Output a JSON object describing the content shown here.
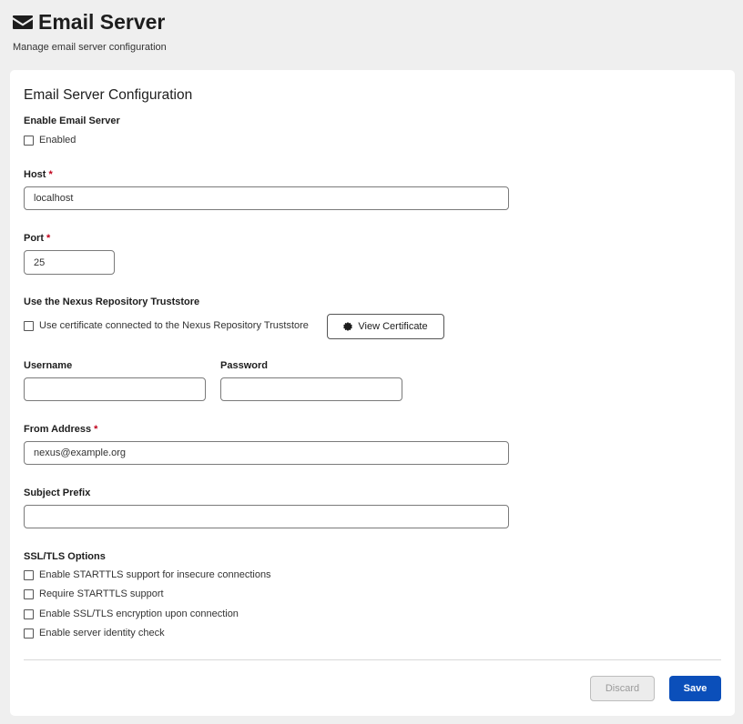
{
  "header": {
    "title": "Email Server",
    "subtitle": "Manage email server configuration",
    "icon": "envelope-icon"
  },
  "card": {
    "title": "Email Server Configuration",
    "enable": {
      "label": "Enable Email Server",
      "checkbox_label": "Enabled",
      "checked": false
    },
    "host": {
      "label": "Host",
      "required_mark": "*",
      "value": "localhost"
    },
    "port": {
      "label": "Port",
      "required_mark": "*",
      "value": "25"
    },
    "truststore": {
      "label": "Use the Nexus Repository Truststore",
      "checkbox_label": "Use certificate connected to the Nexus Repository Truststore",
      "checked": false,
      "view_button": "View Certificate",
      "view_icon": "certificate-icon"
    },
    "username": {
      "label": "Username",
      "value": ""
    },
    "password": {
      "label": "Password",
      "value": ""
    },
    "from_address": {
      "label": "From Address",
      "required_mark": "*",
      "value": "nexus@example.org"
    },
    "subject_prefix": {
      "label": "Subject Prefix",
      "value": ""
    },
    "ssl": {
      "label": "SSL/TLS Options",
      "options": [
        {
          "label": "Enable STARTTLS support for insecure connections",
          "checked": false
        },
        {
          "label": "Require STARTTLS support",
          "checked": false
        },
        {
          "label": "Enable SSL/TLS encryption upon connection",
          "checked": false
        },
        {
          "label": "Enable server identity check",
          "checked": false
        }
      ]
    }
  },
  "footer": {
    "discard_label": "Discard",
    "save_label": "Save"
  },
  "colors": {
    "primary": "#0b4fba",
    "required": "#c0001a",
    "background": "#efefef"
  }
}
